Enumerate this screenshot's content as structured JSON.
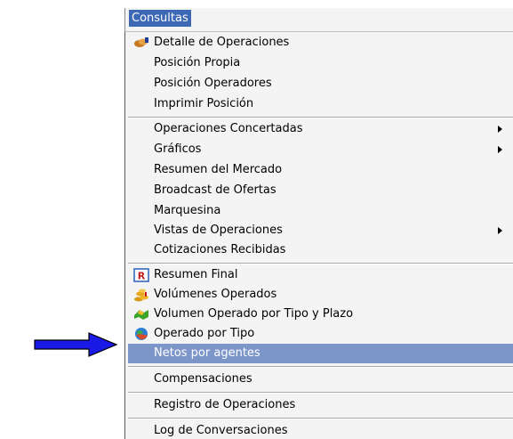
{
  "menu": {
    "title": "Consultas",
    "items": [
      {
        "text": "Detalle de Operaciones",
        "icon": "handshake-icon"
      },
      {
        "text": "Posición Propia"
      },
      {
        "text": "Posición Operadores"
      },
      {
        "text": "Imprimir Posición"
      },
      {
        "text": "Operaciones Concertadas",
        "submenu": true
      },
      {
        "text": "Gráficos",
        "submenu": true
      },
      {
        "text": "Resumen del Mercado"
      },
      {
        "text": "Broadcast de Ofertas"
      },
      {
        "text": "Marquesina"
      },
      {
        "text": "Vistas de Operaciones",
        "submenu": true
      },
      {
        "text": "Cotizaciones Recibidas"
      },
      {
        "text": "Resumen Final",
        "icon": "report-r-icon"
      },
      {
        "text": "Volúmenes Operados",
        "icon": "coins-stack-icon"
      },
      {
        "text": "Volumen Operado por Tipo y Plazo",
        "icon": "green-exchange-icon"
      },
      {
        "text": "Operado por Tipo",
        "icon": "globe-icon"
      },
      {
        "text": "Netos por agentes",
        "highlighted": true
      },
      {
        "text": "Compensaciones"
      },
      {
        "text": "Registro de Operaciones"
      },
      {
        "text": "Log de Conversaciones"
      }
    ]
  },
  "colors": {
    "highlight": "#7c96c9",
    "menu_title_bg": "#3c68b5",
    "pointer_arrow": "#1a1ae6"
  }
}
